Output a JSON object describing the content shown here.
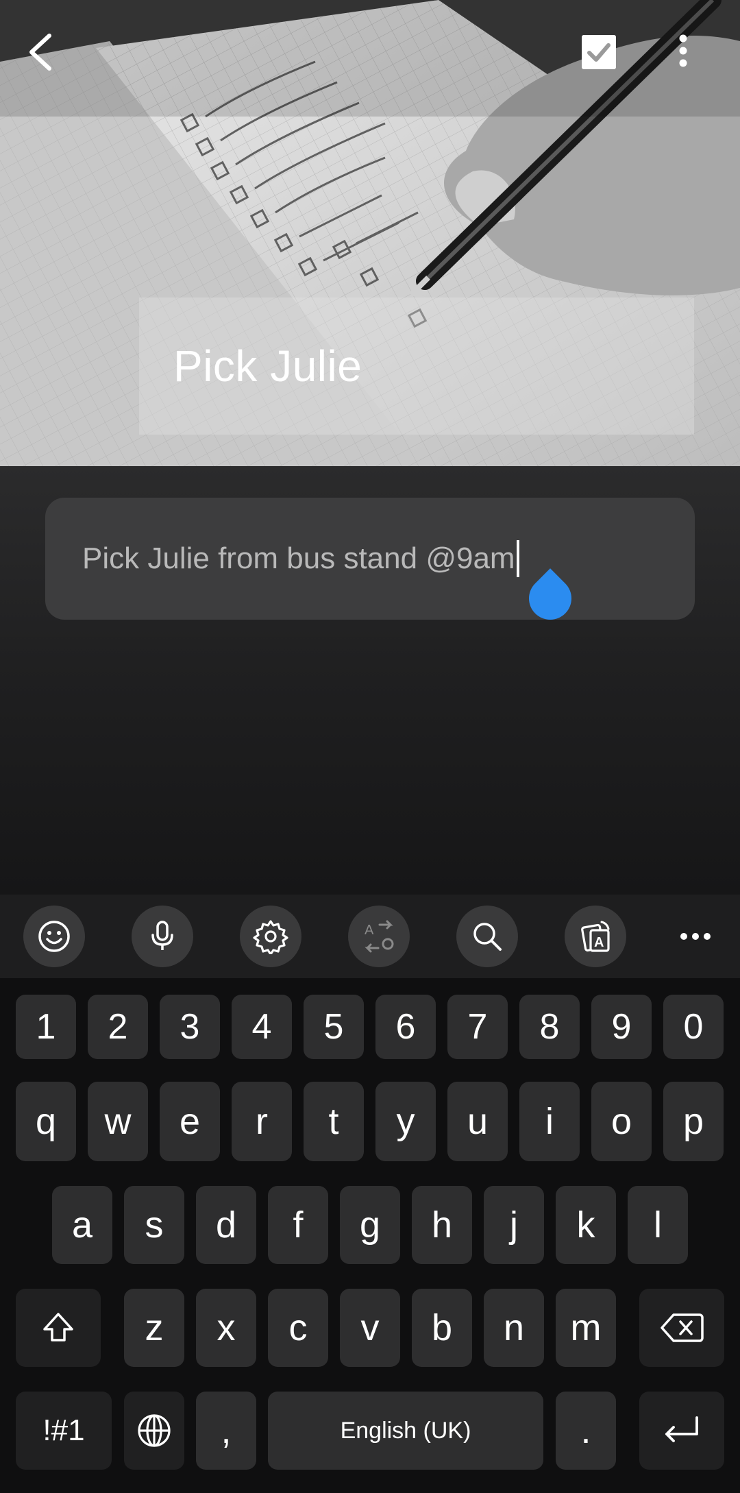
{
  "header": {
    "title": "Pick Julie"
  },
  "note": {
    "text": "Pick Julie from bus stand @9am"
  },
  "toolbar": {
    "items": [
      "emoji",
      "voice-input",
      "settings",
      "translate",
      "search",
      "text-extract",
      "more"
    ]
  },
  "keyboard": {
    "number_row": [
      "1",
      "2",
      "3",
      "4",
      "5",
      "6",
      "7",
      "8",
      "9",
      "0"
    ],
    "row1": [
      "q",
      "w",
      "e",
      "r",
      "t",
      "y",
      "u",
      "i",
      "o",
      "p"
    ],
    "row2": [
      "a",
      "s",
      "d",
      "f",
      "g",
      "h",
      "j",
      "k",
      "l"
    ],
    "row3": [
      "z",
      "x",
      "c",
      "v",
      "b",
      "n",
      "m"
    ],
    "symbols_label": "!#1",
    "comma": ",",
    "space_label": "English (UK)",
    "period": "."
  },
  "colors": {
    "accent": "#2b8cf0",
    "background": "#0f0f10",
    "key": "#2e2e2f",
    "note_field": "#3d3d3e"
  }
}
